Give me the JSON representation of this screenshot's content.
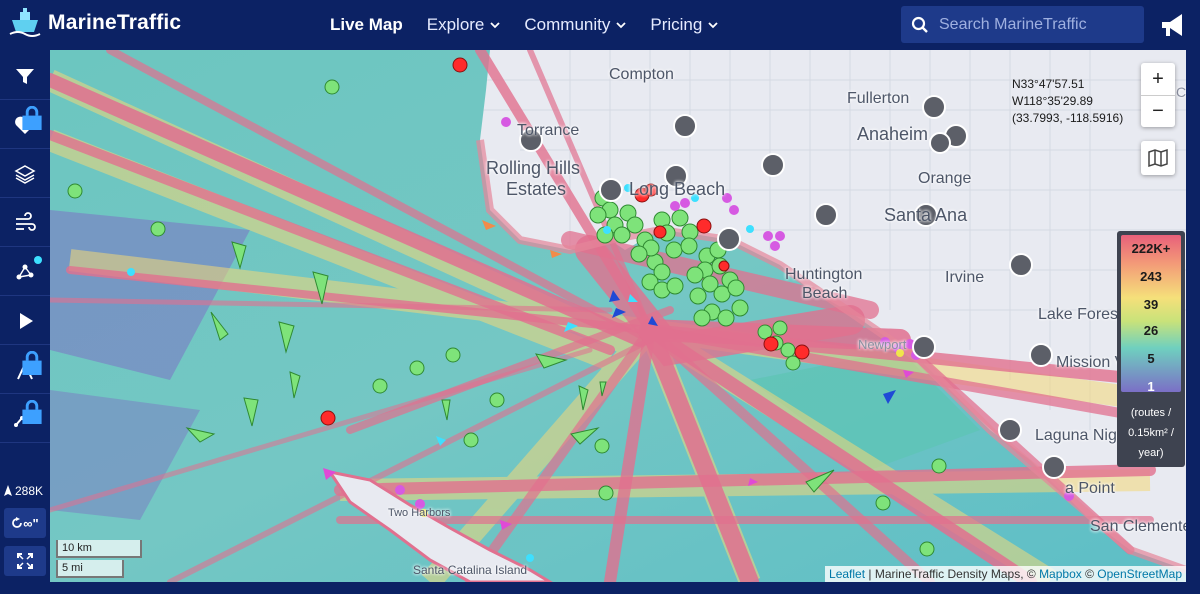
{
  "brand": {
    "name": "MarineTraffic"
  },
  "nav": {
    "items": [
      {
        "label": "Live Map",
        "active": true,
        "dropdown": false
      },
      {
        "label": "Explore",
        "active": false,
        "dropdown": true
      },
      {
        "label": "Community",
        "active": false,
        "dropdown": true
      },
      {
        "label": "Pricing",
        "active": false,
        "dropdown": true
      }
    ]
  },
  "search": {
    "placeholder": "Search MarineTraffic"
  },
  "sidebar": {
    "items": [
      "filter-icon",
      "heart-icon",
      "layers-icon",
      "wind-icon",
      "network-icon",
      "play-icon",
      "measure-icon",
      "route-icon"
    ],
    "vessel_count": "288K",
    "loop_label": "∞\""
  },
  "map": {
    "coordinates": {
      "lat": "N33°47'57.51",
      "lon": "W118°35'29.89",
      "decimal": "(33.7993, -118.5916)"
    },
    "places": [
      {
        "name": "Compton"
      },
      {
        "name": "Fullerton"
      },
      {
        "name": "Anaheim"
      },
      {
        "name": "Torrance"
      },
      {
        "name": "Rolling Hills"
      },
      {
        "name": "Estates"
      },
      {
        "name": "Long Beach"
      },
      {
        "name": "Orange"
      },
      {
        "name": "Santa Ana"
      },
      {
        "name": "Huntington"
      },
      {
        "name": "Beach"
      },
      {
        "name": "Irvine"
      },
      {
        "name": "Lake Forest"
      },
      {
        "name": "Mission V"
      },
      {
        "name": "Laguna Niguel"
      },
      {
        "name": "a Point"
      },
      {
        "name": "San Clemente"
      },
      {
        "name": "Two Harbors"
      },
      {
        "name": "Santa Catalina Island"
      },
      {
        "name": "Newport"
      },
      {
        "name": "Cov"
      }
    ],
    "legend": {
      "labels": [
        "222K+",
        "243",
        "39",
        "26",
        "5",
        "1"
      ],
      "unit_line1": "(routes /",
      "unit_line2": "0.15km² /",
      "unit_line3": "year)"
    },
    "scale": {
      "km": "10 km",
      "mi": "5 mi"
    },
    "attribution": {
      "leaflet": "Leaflet",
      "middle": " | MarineTraffic Density Maps, © ",
      "mapbox": "Mapbox",
      "sep": " © ",
      "osm": "OpenStreetMap"
    },
    "zoom": {
      "in": "+",
      "out": "−"
    }
  }
}
